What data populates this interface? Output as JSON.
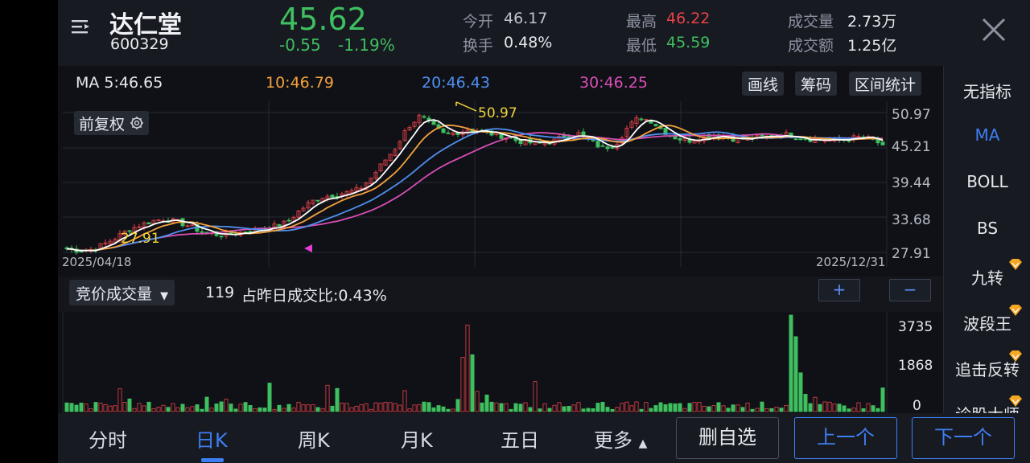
{
  "header": {
    "name": "达仁堂",
    "code": "600329",
    "price": "45.62",
    "change": "-0.55",
    "change_pct": "-1.19%",
    "open_label": "今开",
    "open": "46.17",
    "turnover_label": "换手",
    "turnover": "0.48%",
    "high_label": "最高",
    "high": "46.22",
    "low_label": "最低",
    "low": "45.59",
    "volume_label": "成交量",
    "volume": "2.73万",
    "amount_label": "成交额",
    "amount": "1.25亿"
  },
  "ma": {
    "ma5": "MA 5:46.65",
    "ma10": "10:46.79",
    "ma20": "20:46.43",
    "ma30": "30:46.25"
  },
  "tools": {
    "draw": "画线",
    "chips": "筹码",
    "range_stats": "区间统计"
  },
  "adjust": {
    "label": "前复权"
  },
  "price_axis": [
    "50.97",
    "45.21",
    "39.44",
    "33.68",
    "27.91"
  ],
  "dates": {
    "start": "2025/04/18",
    "end": "2025/12/31"
  },
  "annotations": {
    "max": "50.97",
    "min": "27.91"
  },
  "volume_panel": {
    "select_label": "竞价成交量",
    "info_value": "119",
    "info_ratio": "占昨日成交比:0.43%",
    "plus": "+",
    "minus": "−",
    "axis": [
      "3735",
      "1868",
      "0"
    ]
  },
  "sidebar": {
    "items": [
      "无指标",
      "MA",
      "BOLL",
      "BS",
      "九转",
      "波段王",
      "追击反转",
      "诊股大师"
    ],
    "active": "MA"
  },
  "bottom": {
    "tabs": [
      "分时",
      "日K",
      "周K",
      "月K",
      "五日",
      "更多"
    ],
    "active_tab": "日K",
    "remove_watch": "删自选",
    "prev": "上一个",
    "next": "下一个"
  },
  "colors": {
    "up": "#e8424a",
    "down": "#3fbf5f",
    "ma5": "#ffffff",
    "ma10": "#f5a23c",
    "ma20": "#4f8ff0",
    "ma30": "#d84eb4",
    "accent": "#3e7ef3"
  },
  "chart_data": {
    "type": "candlestick",
    "x_range": [
      "2025/04/18",
      "2025/12/31"
    ],
    "y_range": [
      27.91,
      50.97
    ],
    "y_ticks": [
      50.97,
      45.21,
      39.44,
      33.68,
      27.91
    ],
    "annotated_max": 50.97,
    "annotated_min": 27.91,
    "close_trend": [
      28.5,
      28.2,
      28.4,
      29.2,
      30.3,
      31.6,
      32.4,
      33.1,
      33.4,
      33.0,
      32.3,
      31.4,
      30.9,
      30.8,
      31.1,
      31.5,
      31.8,
      32.2,
      32.8,
      34.6,
      36.2,
      37.1,
      37.4,
      37.8,
      38.3,
      40.2,
      42.8,
      45.2,
      48.6,
      50.4,
      48.8,
      47.3,
      47.7,
      48.2,
      47.9,
      47.4,
      47.0,
      46.3,
      46.0,
      45.8,
      46.3,
      47.2,
      47.5,
      46.2,
      45.1,
      45.6,
      48.4,
      50.2,
      49.6,
      47.9,
      46.8,
      46.3,
      46.9,
      47.3,
      47.1,
      46.5,
      46.7,
      46.9,
      47.1,
      47.4,
      46.9,
      46.6,
      46.5,
      46.3,
      46.6,
      46.9,
      46.6,
      45.62
    ],
    "volume_axis": [
      3735,
      1868,
      0
    ],
    "volume_spikes": [
      {
        "region": "early-December",
        "value": 3735
      },
      {
        "region": "late-July",
        "value": 3350
      }
    ]
  }
}
